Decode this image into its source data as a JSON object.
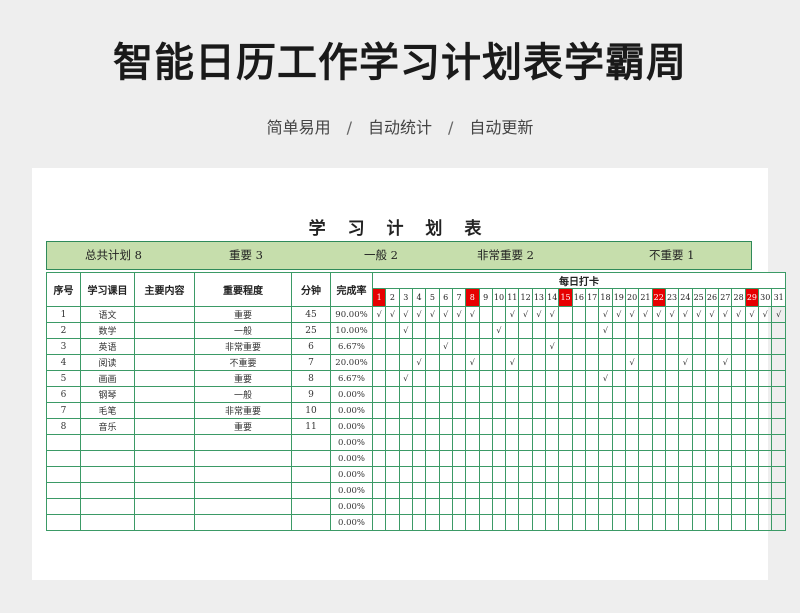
{
  "page": {
    "title": "智能日历工作学习计划表学霸周",
    "tagline": [
      "简单易用",
      "/",
      "自动统计",
      "/",
      "自动更新"
    ]
  },
  "sheet": {
    "title": "学 习 计 划 表",
    "summary": {
      "total": "总共计划 8",
      "important": "重要 3",
      "normal": "一般 2",
      "very_important": "非常重要 2",
      "not_important": "不重要 1"
    },
    "headers": {
      "index": "序号",
      "course": "学习课目",
      "content": "主要内容",
      "level": "重要程度",
      "minutes": "分钟",
      "rate": "完成率",
      "checkin": "每日打卡"
    },
    "days": [
      "1",
      "2",
      "3",
      "4",
      "5",
      "6",
      "7",
      "8",
      "9",
      "10",
      "11",
      "12",
      "13",
      "14",
      "15",
      "16",
      "17",
      "18",
      "19",
      "20",
      "21",
      "22",
      "23",
      "24",
      "25",
      "26",
      "27",
      "28",
      "29",
      "30",
      "31"
    ],
    "highlight_days": [
      1,
      8,
      15,
      22,
      29
    ],
    "highlight_color": "#e60000",
    "check_mark": "√",
    "rows": [
      {
        "no": "1",
        "course": "语文",
        "content": "",
        "level": "重要",
        "minutes": "45",
        "rate": "90.00%",
        "checks": [
          1,
          2,
          3,
          4,
          5,
          6,
          7,
          8,
          11,
          12,
          13,
          14,
          18,
          19,
          20,
          21,
          22,
          23,
          24,
          25,
          26,
          27,
          28,
          29,
          30,
          31
        ]
      },
      {
        "no": "2",
        "course": "数学",
        "content": "",
        "level": "一般",
        "minutes": "25",
        "rate": "10.00%",
        "checks": [
          3,
          10,
          18
        ]
      },
      {
        "no": "3",
        "course": "英语",
        "content": "",
        "level": "非常重要",
        "minutes": "6",
        "rate": "6.67%",
        "checks": [
          6,
          14
        ]
      },
      {
        "no": "4",
        "course": "阅读",
        "content": "",
        "level": "不重要",
        "minutes": "7",
        "rate": "20.00%",
        "checks": [
          4,
          8,
          11,
          20,
          24,
          27
        ]
      },
      {
        "no": "5",
        "course": "画画",
        "content": "",
        "level": "重要",
        "minutes": "8",
        "rate": "6.67%",
        "checks": [
          3,
          18
        ]
      },
      {
        "no": "6",
        "course": "钢琴",
        "content": "",
        "level": "一般",
        "minutes": "9",
        "rate": "0.00%",
        "checks": []
      },
      {
        "no": "7",
        "course": "毛笔",
        "content": "",
        "level": "非常重要",
        "minutes": "10",
        "rate": "0.00%",
        "checks": []
      },
      {
        "no": "8",
        "course": "音乐",
        "content": "",
        "level": "重要",
        "minutes": "11",
        "rate": "0.00%",
        "checks": []
      },
      {
        "no": "",
        "course": "",
        "content": "",
        "level": "",
        "minutes": "",
        "rate": "0.00%",
        "checks": []
      },
      {
        "no": "",
        "course": "",
        "content": "",
        "level": "",
        "minutes": "",
        "rate": "0.00%",
        "checks": []
      },
      {
        "no": "",
        "course": "",
        "content": "",
        "level": "",
        "minutes": "",
        "rate": "0.00%",
        "checks": []
      },
      {
        "no": "",
        "course": "",
        "content": "",
        "level": "",
        "minutes": "",
        "rate": "0.00%",
        "checks": []
      },
      {
        "no": "",
        "course": "",
        "content": "",
        "level": "",
        "minutes": "",
        "rate": "0.00%",
        "checks": []
      },
      {
        "no": "",
        "course": "",
        "content": "",
        "level": "",
        "minutes": "",
        "rate": "0.00%",
        "checks": []
      }
    ]
  }
}
